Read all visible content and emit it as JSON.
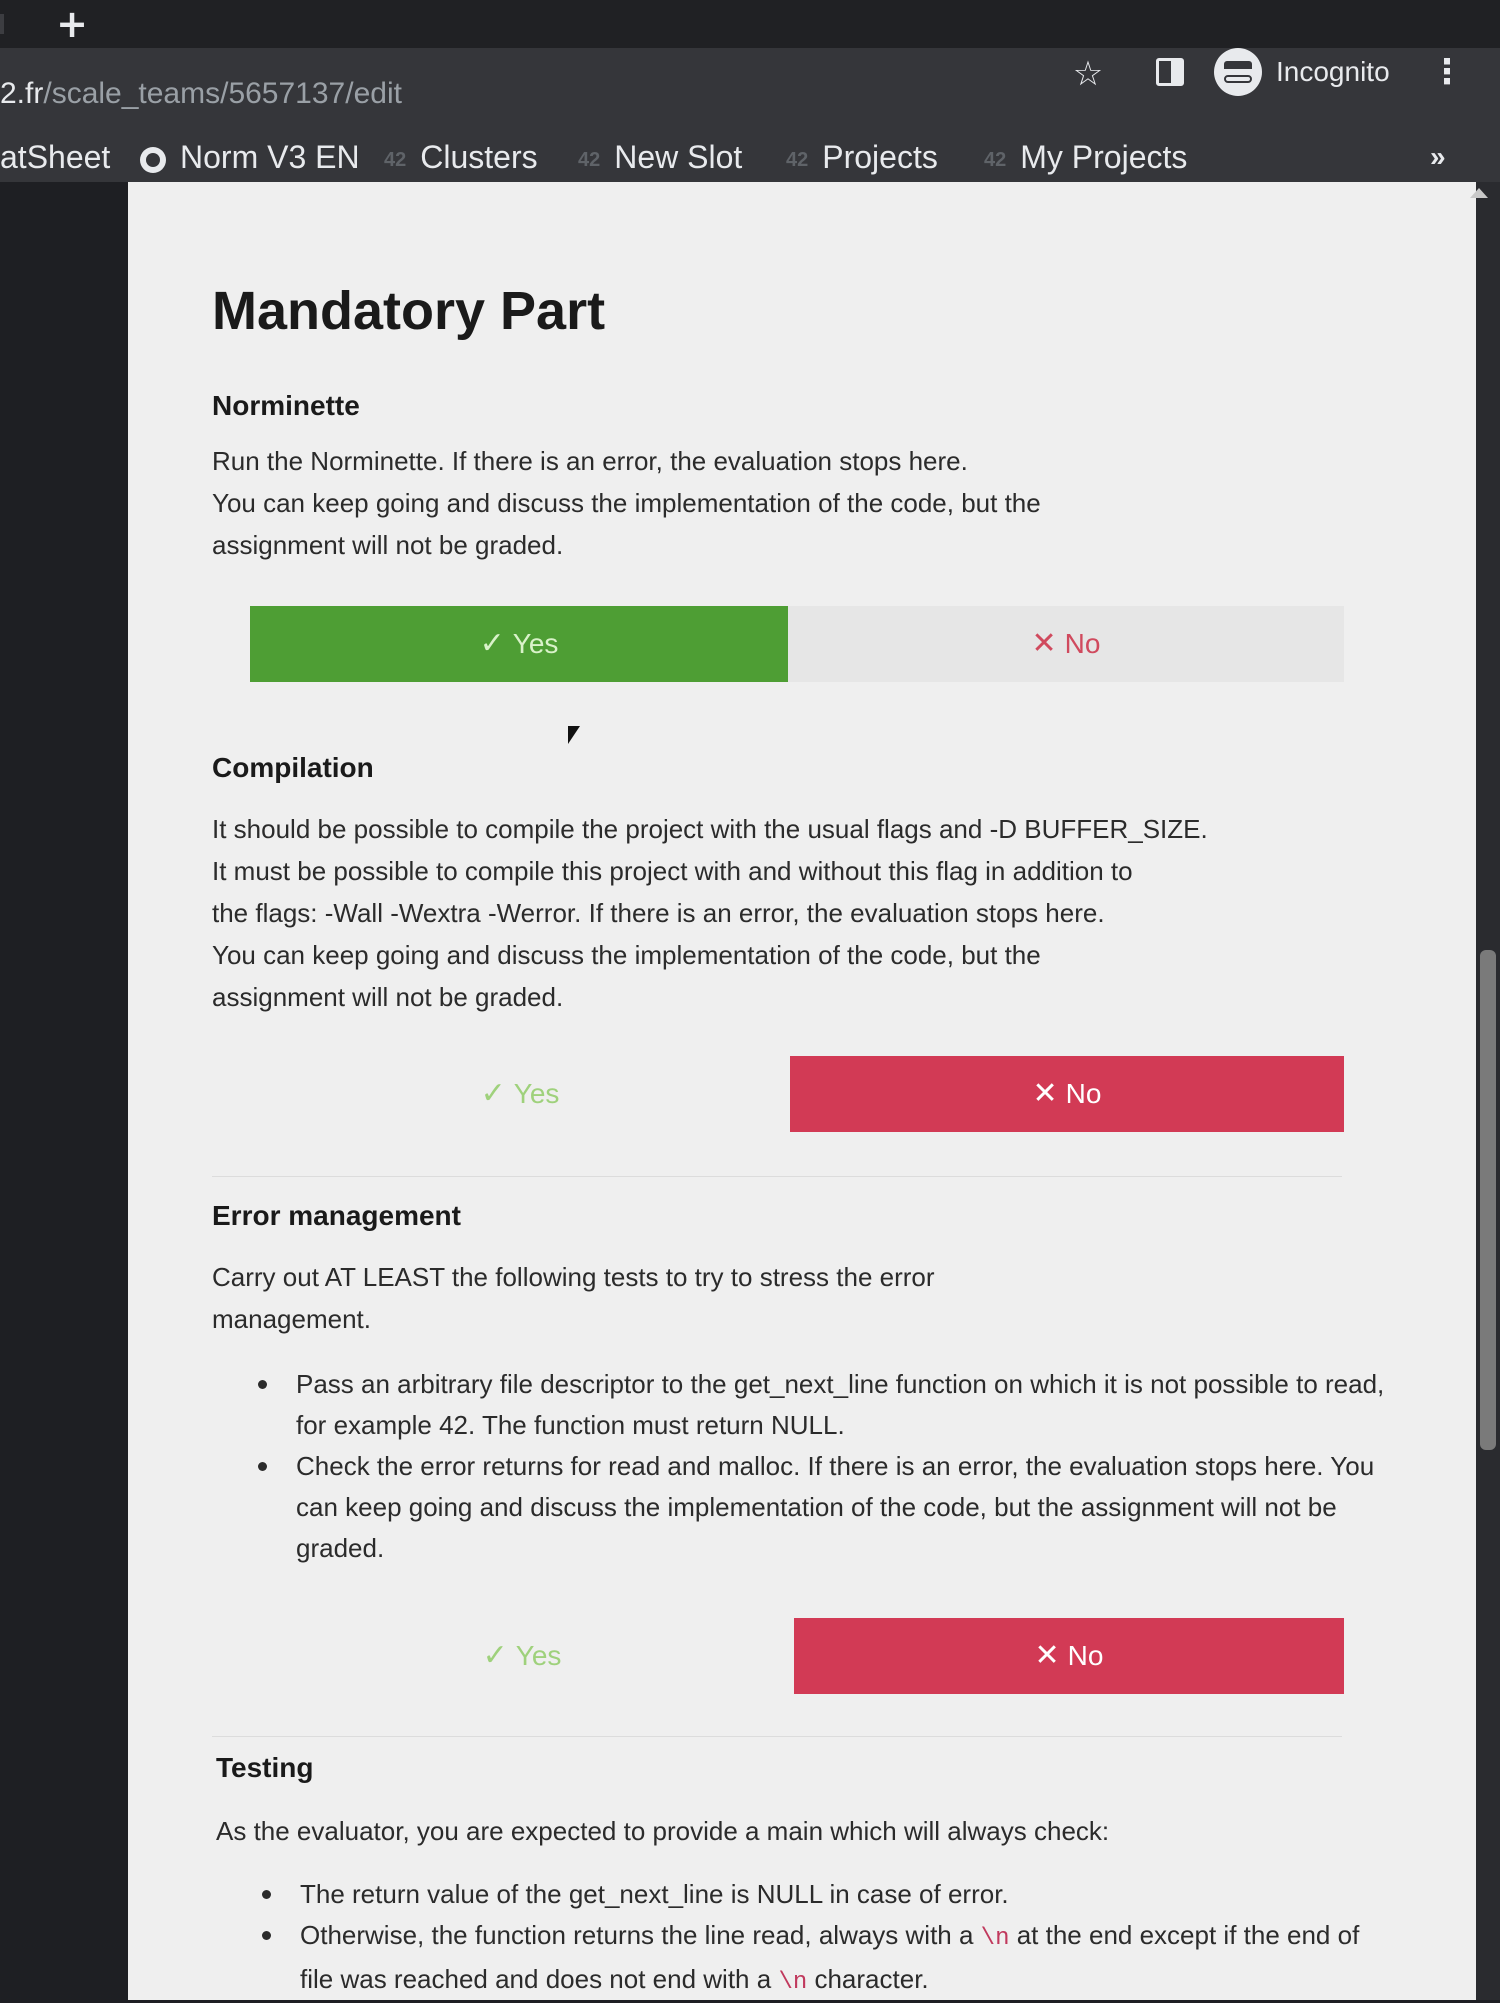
{
  "browser": {
    "url_host": "2.fr",
    "url_path": "/scale_teams/5657137/edit",
    "new_tab": "+",
    "profile_label": "Incognito",
    "bookmarks": [
      {
        "label": "atSheet"
      },
      {
        "label": "Norm V3 EN"
      },
      {
        "label": "Clusters"
      },
      {
        "label": "New Slot"
      },
      {
        "label": "Projects"
      },
      {
        "label": "My Projects"
      }
    ],
    "bookmark_badge": "42",
    "more_bookmarks": "»"
  },
  "page": {
    "title": "Mandatory Part",
    "sections": [
      {
        "heading": "Norminette",
        "lines": [
          "Run the Norminette. If there is an error, the evaluation stops here.",
          "You can keep going and discuss the implementation of the code, but the",
          "assignment will not be graded."
        ],
        "answer": "yes"
      },
      {
        "heading": "Compilation",
        "lines": [
          "It should be possible to compile the project with the usual flags and -D BUFFER_SIZE.",
          "It must be possible to compile this project with and without this flag in addition to",
          "the flags: -Wall -Wextra -Werror. If there is an error, the evaluation stops here.",
          "You can keep going and discuss the implementation of the code, but the",
          "assignment will not be graded."
        ],
        "answer": "no"
      },
      {
        "heading": "Error management",
        "lines": [
          "Carry out AT LEAST the following tests to try to stress the error",
          "management."
        ],
        "bullets": [
          "Pass an arbitrary file descriptor to the get_next_line function on which it is not possible to read, for example 42. The function must return NULL.",
          "Check the error returns for read and malloc. If there is an error, the evaluation stops here. You can keep going and discuss the implementation of the code, but the assignment will not be graded."
        ],
        "answer": "no"
      },
      {
        "heading": "Testing",
        "lines": [
          "As the evaluator, you are expected to provide a main which will always check:"
        ],
        "bullet1": "The return value of the get_next_line is NULL in case of error.",
        "bullet2_a": "Otherwise, the function returns the line read, always with a ",
        "bullet2_code1": "\\n",
        "bullet2_b": " at the end except if the end of file was reached and does not end with a ",
        "bullet2_code2": "\\n",
        "bullet2_c": " character."
      }
    ],
    "yes_label": "Yes",
    "no_label": "No"
  },
  "colors": {
    "yes_selected": "#4e9e34",
    "no_selected": "#d23a55"
  }
}
